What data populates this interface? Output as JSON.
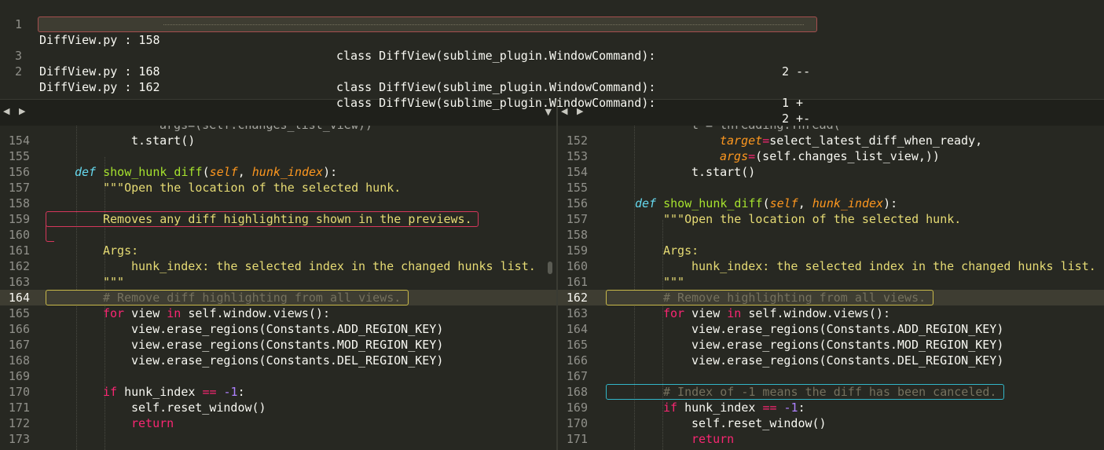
{
  "results": [
    {
      "num": "1",
      "file": "DiffView.py : 158",
      "cls": "class DiffView(sublime_plugin.WindowCommand):",
      "count": "2 --"
    },
    {
      "num": "2",
      "file": "DiffView.py : 162",
      "cls": "class DiffView(sublime_plugin.WindowCommand):",
      "count": "2 +-"
    },
    {
      "num": "3",
      "file": "DiffView.py : 168",
      "cls": "class DiffView(sublime_plugin.WindowCommand):",
      "count": "1 +"
    }
  ],
  "tabbar": {
    "arrows": "◀ ▶",
    "menu": "▼"
  },
  "left": {
    "partial_top": "args=(self.changes_list_view))",
    "line_numbers": [
      "154",
      "155",
      "156",
      "157",
      "158",
      "159",
      "160",
      "161",
      "162",
      "163",
      "164",
      "165",
      "166",
      "167",
      "168",
      "169",
      "170",
      "171",
      "172",
      "173"
    ],
    "code": {
      "l154": "t.start()",
      "l156_def": "def",
      "l156_fn": "show_hunk_diff",
      "l156_self": "self",
      "l156_arg": "hunk_index",
      "l157": "\"\"\"Open the location of the selected hunk.",
      "l159": "Removes any diff highlighting shown in the previews.",
      "l161": "Args:",
      "l162": "hunk_index: the selected index in the changed hunks list.",
      "l163": "\"\"\"",
      "l164": "# Remove diff highlighting from all views.",
      "l165_for": "for",
      "l165_in": "in",
      "l165_rest": "self.window.views():",
      "l166": "view.erase_regions(Constants.ADD_REGION_KEY)",
      "l167": "view.erase_regions(Constants.MOD_REGION_KEY)",
      "l168": "view.erase_regions(Constants.DEL_REGION_KEY)",
      "l170_if": "if",
      "l170_var": "hunk_index",
      "l170_op": "==",
      "l170_num": "-1",
      "l171": "self.reset_window()",
      "l172": "return"
    }
  },
  "right": {
    "partial_top": "t = threading.Thread(",
    "line_numbers": [
      "152",
      "153",
      "154",
      "155",
      "156",
      "157",
      "158",
      "159",
      "160",
      "161",
      "162",
      "163",
      "164",
      "165",
      "166",
      "167",
      "168",
      "169",
      "170",
      "171"
    ],
    "code": {
      "l152_kw": "target",
      "l152_rest": "select_latest_diff_when_ready,",
      "l153_kw": "args",
      "l153_rest": "(self.changes_list_view,))",
      "l154": "t.start()",
      "l156_def": "def",
      "l156_fn": "show_hunk_diff",
      "l156_self": "self",
      "l156_arg": "hunk_index",
      "l157": "\"\"\"Open the location of the selected hunk.",
      "l159": "Args:",
      "l160": "hunk_index: the selected index in the changed hunks list.",
      "l161": "\"\"\"",
      "l162": "# Remove highlighting from all views.",
      "l163_for": "for",
      "l163_in": "in",
      "l163_rest": "self.window.views():",
      "l164": "view.erase_regions(Constants.ADD_REGION_KEY)",
      "l165": "view.erase_regions(Constants.MOD_REGION_KEY)",
      "l166": "view.erase_regions(Constants.DEL_REGION_KEY)",
      "l168": "# Index of -1 means the diff has been canceled.",
      "l169_if": "if",
      "l169_var": "hunk_index",
      "l169_op": "==",
      "l169_num": "-1",
      "l170": "self.reset_window()",
      "l171": "return"
    }
  },
  "colors": {
    "removed": "#d6375c",
    "modified": "#c9b94a",
    "added": "#32b6c8",
    "selection": "#3e3d32"
  }
}
